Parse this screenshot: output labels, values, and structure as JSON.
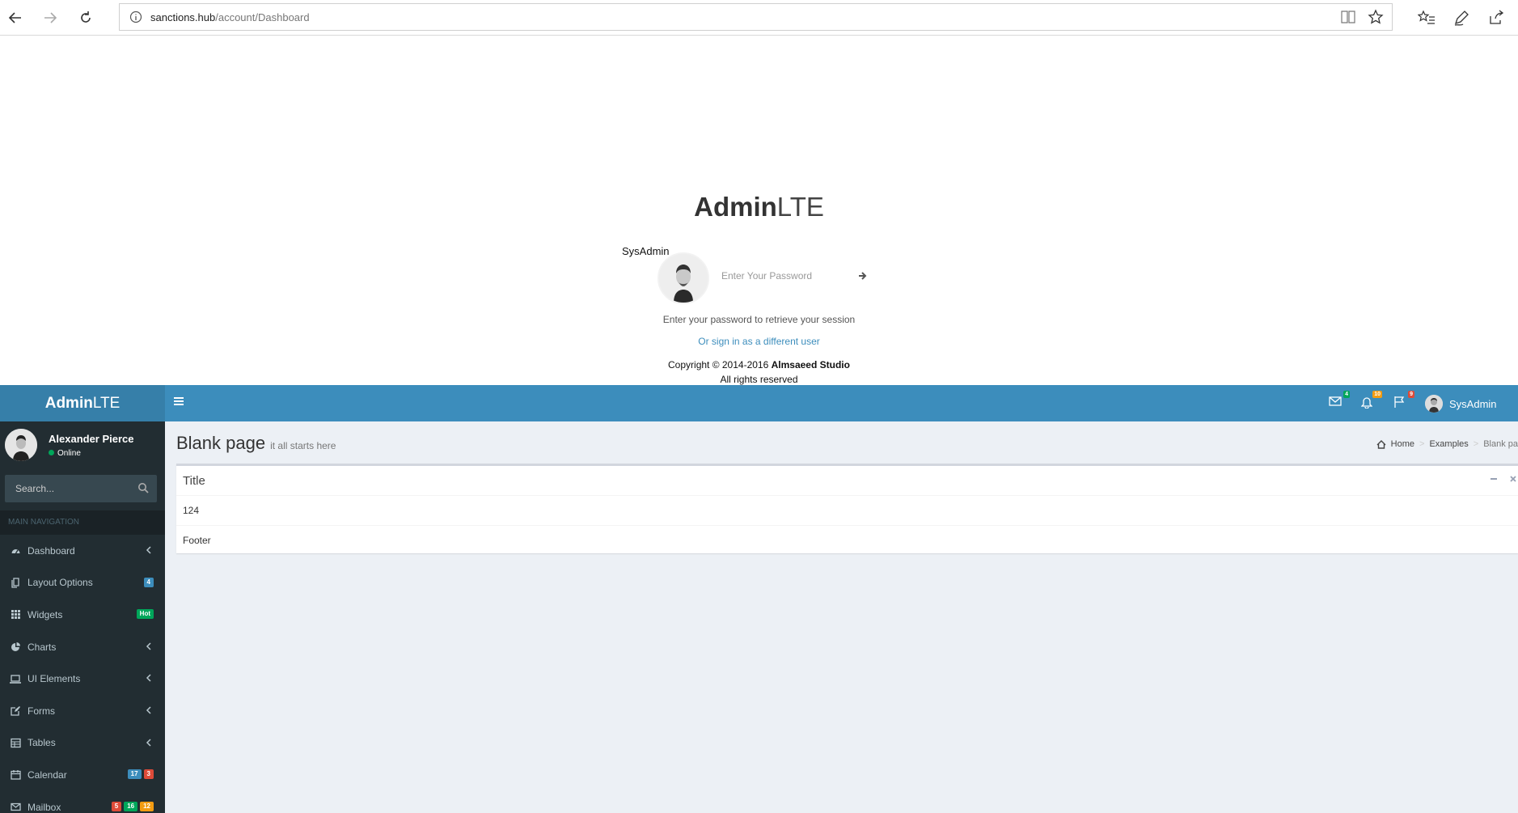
{
  "browser": {
    "url_host": "sanctions.hub",
    "url_path": "/account/Dashboard"
  },
  "lockscreen": {
    "logo_bold": "Admin",
    "logo_light": "LTE",
    "user_name": "SysAdmin",
    "password_placeholder": "Enter Your Password",
    "help_text": "Enter your password to retrieve your session",
    "switch_link": "Or sign in as a different user",
    "copyright_prefix": "Copyright © 2014-2016 ",
    "copyright_company": "Almsaeed Studio",
    "rights": "All rights reserved"
  },
  "header": {
    "brand_bold": "Admin",
    "brand_light": "LTE",
    "messages_count": "4",
    "notifications_count": "10",
    "tasks_count": "9",
    "user_name": "SysAdmin",
    "colors": {
      "bar": "#3c8dbc",
      "brand": "#367fa9"
    }
  },
  "sidebar": {
    "user_name": "Alexander Pierce",
    "status": "Online",
    "search_placeholder": "Search...",
    "nav_header": "MAIN NAVIGATION",
    "items": [
      {
        "label": "Dashboard",
        "icon": "dashboard-icon",
        "chevron": true
      },
      {
        "label": "Layout Options",
        "icon": "files-icon",
        "badges": [
          {
            "text": "4",
            "color": "#3c8dbc"
          }
        ]
      },
      {
        "label": "Widgets",
        "icon": "grid-icon",
        "badges": [
          {
            "text": "Hot",
            "color": "#00a65a"
          }
        ]
      },
      {
        "label": "Charts",
        "icon": "pie-chart-icon",
        "chevron": true
      },
      {
        "label": "UI Elements",
        "icon": "laptop-icon",
        "chevron": true
      },
      {
        "label": "Forms",
        "icon": "edit-icon",
        "chevron": true
      },
      {
        "label": "Tables",
        "icon": "table-icon",
        "chevron": true
      },
      {
        "label": "Calendar",
        "icon": "calendar-icon",
        "badges": [
          {
            "text": "17",
            "color": "#3c8dbc"
          },
          {
            "text": "3",
            "color": "#dd4b39"
          }
        ]
      },
      {
        "label": "Mailbox",
        "icon": "envelope-icon",
        "badges": [
          {
            "text": "5",
            "color": "#dd4b39"
          },
          {
            "text": "16",
            "color": "#00a65a"
          },
          {
            "text": "12",
            "color": "#f39c12"
          }
        ]
      }
    ]
  },
  "content": {
    "title": "Blank page",
    "subtitle": "it all starts here",
    "breadcrumb": [
      "Home",
      "Examples",
      "Blank pa"
    ],
    "box": {
      "title": "Title",
      "body": "124",
      "footer": "Footer"
    }
  }
}
